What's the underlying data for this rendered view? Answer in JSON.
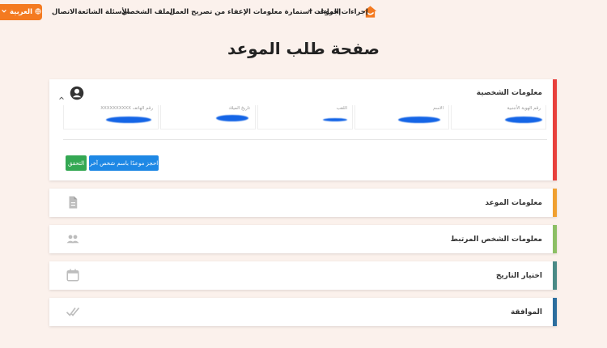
{
  "nav": {
    "items": [
      {
        "label": "إجراءات الموعد",
        "has_dropdown": true
      },
      {
        "label": "إجراءات استمارة معلومات الإعفاء من تصريح العمل",
        "has_dropdown": false
      },
      {
        "label": "الملف الشخصي",
        "has_dropdown": false
      },
      {
        "label": "الأسئلة الشائعة",
        "has_dropdown": false
      },
      {
        "label": "الاتصال",
        "has_dropdown": false
      }
    ],
    "language": {
      "label": "العربية"
    },
    "home_icon": "home-icon",
    "accent": "#f47a20"
  },
  "page_title": "صفحة طلب الموعد",
  "sections": {
    "personal": {
      "title": "معلومات الشخصية",
      "bar_color": "#e8403c",
      "icon": "account-circle-icon",
      "fields": [
        {
          "label": "رقم الهوية الأجنبية",
          "value": ""
        },
        {
          "label": "الاسم",
          "value": ""
        },
        {
          "label": "اللقب",
          "value": ""
        },
        {
          "label": "تاريخ الميلاد",
          "value": ""
        },
        {
          "label": "رقم الهاتف",
          "value": "XXXXXXXXXX"
        }
      ],
      "book_other_label": "احجز موعدًا باسم شخص آخر",
      "verify_label": "التحقق"
    },
    "appointment": {
      "title": "معلومات الموعد",
      "bar_color": "#f0a030",
      "icon": "document-icon"
    },
    "related": {
      "title": "معلومات الشخص المرتبط",
      "bar_color": "#8cbf64",
      "icon": "people-icon"
    },
    "date": {
      "title": "اختيار التاريخ",
      "bar_color": "#4a8a86",
      "icon": "calendar-icon"
    },
    "approval": {
      "title": "الموافقة",
      "bar_color": "#2c6e9e",
      "icon": "double-check-icon"
    }
  }
}
